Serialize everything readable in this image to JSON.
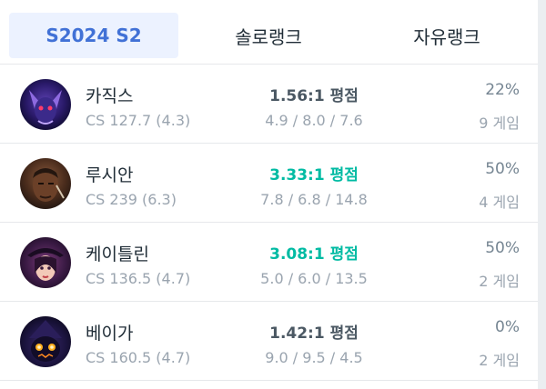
{
  "tabs": [
    {
      "label": "S2024 S2",
      "active": true
    },
    {
      "label": "솔로랭크",
      "active": false
    },
    {
      "label": "자유랭크",
      "active": false
    }
  ],
  "champions": [
    {
      "name": "카직스",
      "cs": "CS 127.7 (4.3)",
      "kda_ratio": "1.56:1 평점",
      "kda": "4.9 / 8.0 / 7.6",
      "winrate": "22%",
      "games": "9 게임",
      "kda_good": false
    },
    {
      "name": "루시안",
      "cs": "CS 239 (6.3)",
      "kda_ratio": "3.33:1 평점",
      "kda": "7.8 / 6.8 / 14.8",
      "winrate": "50%",
      "games": "4 게임",
      "kda_good": true
    },
    {
      "name": "케이틀린",
      "cs": "CS 136.5 (4.7)",
      "kda_ratio": "3.08:1 평점",
      "kda": "5.0 / 6.0 / 13.5",
      "winrate": "50%",
      "games": "2 게임",
      "kda_good": true
    },
    {
      "name": "베이가",
      "cs": "CS 160.5 (4.7)",
      "kda_ratio": "1.42:1 평점",
      "kda": "9.0 / 9.5 / 4.5",
      "winrate": "0%",
      "games": "2 게임",
      "kda_good": false
    }
  ],
  "colors": {
    "accent": "#4171d6",
    "good_kda": "#00bba3",
    "text": "#202d37",
    "muted": "#9aa4af"
  }
}
